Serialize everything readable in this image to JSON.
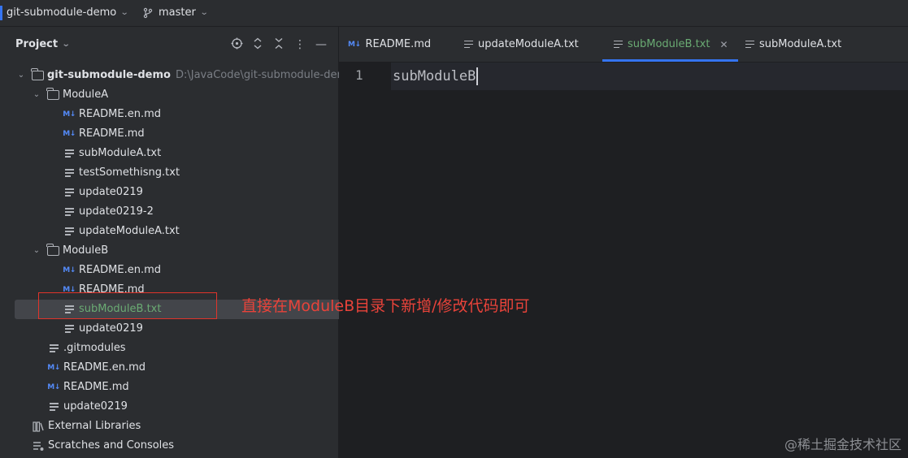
{
  "topbar": {
    "project_name": "git-submodule-demo",
    "branch": "master"
  },
  "panel": {
    "title": "Project"
  },
  "tree": {
    "root_label": "git-submodule-demo",
    "root_path": "D:\\JavaCode\\git-submodule-demo",
    "moduleA": {
      "label": "ModuleA",
      "files": [
        "README.en.md",
        "README.md",
        "subModuleA.txt",
        "testSomethisng.txt",
        "update0219",
        "update0219-2",
        "updateModuleA.txt"
      ]
    },
    "moduleB": {
      "label": "ModuleB",
      "files": [
        "README.en.md",
        "README.md",
        "subModuleB.txt",
        "update0219"
      ]
    },
    "root_files": [
      ".gitmodules",
      "README.en.md",
      "README.md",
      "update0219"
    ],
    "external_libraries": "External Libraries",
    "scratches": "Scratches and Consoles"
  },
  "tabs": [
    "README.md",
    "updateModuleA.txt",
    "subModuleB.txt",
    "subModuleA.txt"
  ],
  "editor": {
    "line_number": "1",
    "content": "subModuleB"
  },
  "annotation": "直接在ModuleB目录下新增/修改代码即可",
  "watermark": "@稀土掘金技术社区",
  "colors": {
    "accent": "#3574f0",
    "selected_file": "#6aab73",
    "annotation": "#e8433a"
  }
}
